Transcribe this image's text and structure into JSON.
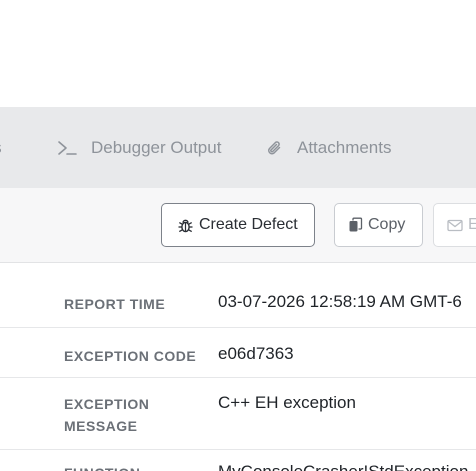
{
  "tabs": [
    {
      "label": "tes",
      "icon": "document-icon"
    },
    {
      "label": "Debugger Output",
      "icon": "terminal-prompt-icon"
    },
    {
      "label": "Attachments",
      "icon": "paperclip-icon"
    }
  ],
  "toolbar": {
    "create_defect_label": "Create Defect",
    "create_defect_icon": "bug-icon",
    "copy_label": "Copy",
    "copy_icon": "copy-icon",
    "email_label": "E",
    "email_icon": "envelope-icon"
  },
  "details": [
    {
      "key": "REPORT TIME",
      "value": "03-07-2026 12:58:19 AM GMT-6"
    },
    {
      "key": "EXCEPTION CODE",
      "value": "e06d7363"
    },
    {
      "key": "EXCEPTION MESSAGE",
      "value": "C++ EH exception"
    },
    {
      "key": "FUNCTION",
      "value": "MyConsoleCrasher!StdException"
    }
  ],
  "colors": {
    "tab_bar_bg": "#e8e9eb",
    "tab_text": "#8e939a",
    "toolbar_bg": "#f7f7f8",
    "key_text": "#6b7077",
    "value_text": "#1f2328"
  }
}
